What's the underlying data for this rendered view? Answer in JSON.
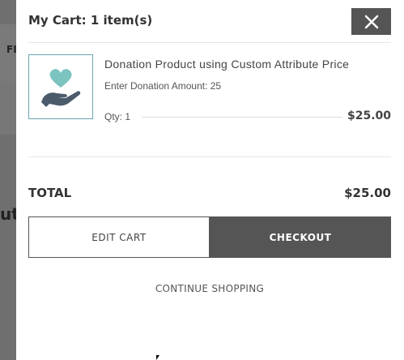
{
  "background": {
    "header_fragment": "FI",
    "heading_fragment": "ute"
  },
  "cart": {
    "title": "My Cart: 1 item(s)",
    "close_icon": "close-icon",
    "items": [
      {
        "name": "Donation Product using Custom Attribute Price",
        "attribute": "Enter Donation Amount: 25",
        "qty": "Qty: 1",
        "price": "$25.00",
        "thumbnail_icon": "heart-hand-icon"
      }
    ],
    "total_label": "TOTAL",
    "total_value": "$25.00",
    "edit_cart_label": "EDIT CART",
    "checkout_label": "CHECKOUT",
    "continue_label": "CONTINUE SHOPPING"
  },
  "colors": {
    "accent": "#555555",
    "heart": "#7cc4bf",
    "hand": "#4b5b6b",
    "thumb_border": "#6aa6b0"
  }
}
